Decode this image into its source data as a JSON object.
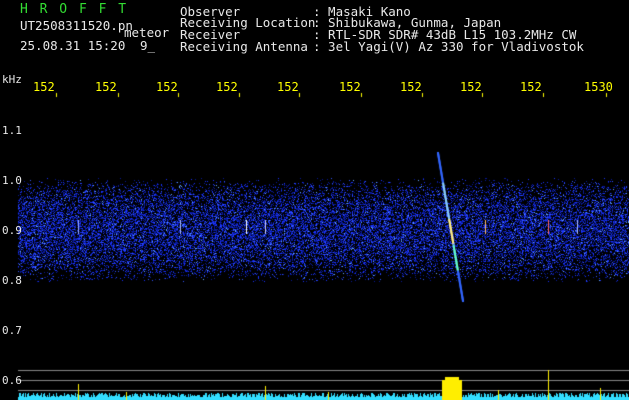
{
  "app": {
    "brand": "H R O F F T",
    "filename": "UT2508311520.pn",
    "detection": "meteor",
    "datetime": "25.08.31 15:20",
    "minute_label": "9_"
  },
  "station": {
    "fields": [
      {
        "label": "Observer",
        "value": ": Masaki Kano"
      },
      {
        "label": "Receiving Location",
        "value": ": Shibukawa, Gunma, Japan"
      },
      {
        "label": "Receiver",
        "value": ": RTL-SDR SDR# 43dB L15 103.2MHz CW"
      },
      {
        "label": "Receiving Antenna",
        "value": ": 3el Yagi(V) Az 330 for Vladivostok"
      }
    ]
  },
  "axes": {
    "unit": "kHz",
    "time_ticks": [
      "152",
      "152",
      "152",
      "152",
      "152",
      "152",
      "152",
      "152",
      "152",
      "1530"
    ],
    "freq_ticks": [
      "1.1",
      "1.0",
      "0.9",
      "0.8",
      "0.7",
      "0.6"
    ]
  },
  "colors": {
    "header_text": "#e8e8e8",
    "brand": "#33dd33",
    "ticks": "#ffff00",
    "noise": "#1a33ff",
    "baseline": "#33ddff",
    "spike": "#ffee00"
  }
}
